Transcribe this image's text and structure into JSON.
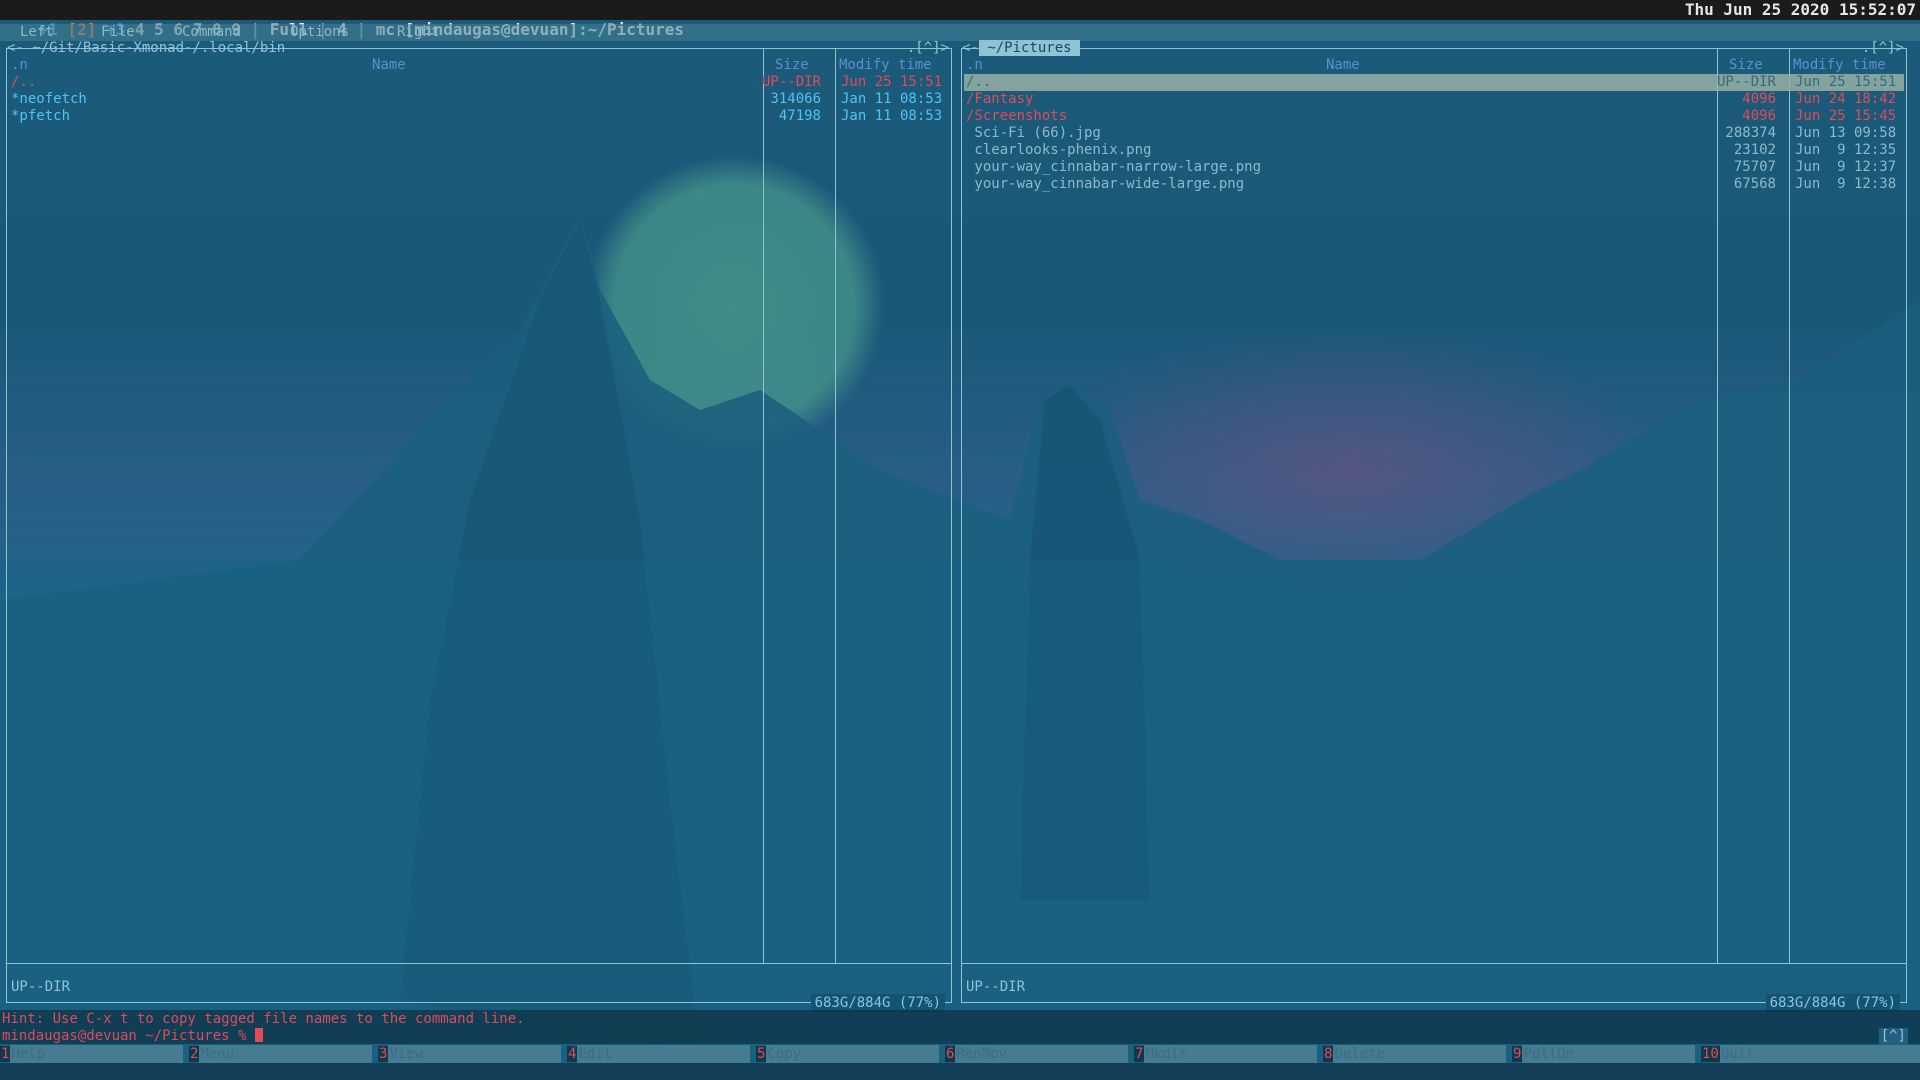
{
  "topbar": {
    "ws_prev": "+1",
    "ws_current": "[2]",
    "ws_visible": "+3",
    "ws_others": "4 5 6 7 8 9",
    "sep": "|",
    "layout": "Full",
    "window_count": "4",
    "window_title": "mc [mindaugas@devuan]:~/Pictures",
    "clock": "Thu Jun 25 2020 15:52:07"
  },
  "menubar": {
    "left": "Left",
    "file": "File",
    "command": "Command",
    "options": "Options",
    "right": "Right"
  },
  "left_panel": {
    "title": "<- ~/Git/Basic-Xmonad-/.local/bin",
    "corner": ".[^]>",
    "header": {
      "sort": ".n",
      "name": "Name",
      "size": "Size",
      "mtime": "Modify time"
    },
    "rows": [
      {
        "name": "/..",
        "size": "UP--DIR",
        "mtime": "Jun 25 15:51",
        "kind": "dir"
      },
      {
        "name": "*neofetch",
        "size": "314066",
        "mtime": "Jan 11 08:53",
        "kind": "exec"
      },
      {
        "name": "*pfetch",
        "size": "47198",
        "mtime": "Jan 11 08:53",
        "kind": "exec"
      }
    ],
    "mini_status": "UP--DIR",
    "free_space": "683G/884G (77%)"
  },
  "right_panel": {
    "title": "<- ~/Pictures",
    "title_arrow": "<-",
    "title_path": " ~/Pictures ",
    "corner": ".[^]>",
    "header": {
      "sort": ".n",
      "name": "Name",
      "size": "Size",
      "mtime": "Modify time"
    },
    "rows": [
      {
        "name": "/..",
        "size": "UP--DIR",
        "mtime": "Jun 25 15:51",
        "kind": "sel"
      },
      {
        "name": "/Fantasy",
        "size": "4096",
        "mtime": "Jun 24 18:42",
        "kind": "dir"
      },
      {
        "name": "/Screenshots",
        "size": "4096",
        "mtime": "Jun 25 15:45",
        "kind": "dir"
      },
      {
        "name": " Sci-Fi (66).jpg",
        "size": "288374",
        "mtime": "Jun 13 09:58",
        "kind": "file"
      },
      {
        "name": " clearlooks-phenix.png",
        "size": "23102",
        "mtime": "Jun  9 12:35",
        "kind": "file"
      },
      {
        "name": " your-way_cinnabar-narrow-large.png",
        "size": "75707",
        "mtime": "Jun  9 12:37",
        "kind": "file"
      },
      {
        "name": " your-way_cinnabar-wide-large.png",
        "size": "67568",
        "mtime": "Jun  9 12:38",
        "kind": "file"
      }
    ],
    "mini_status": "UP--DIR",
    "free_space": "683G/884G (77%)"
  },
  "hint": {
    "text": "Hint: Use C-x t to copy tagged file names to the command line.",
    "prompt": "mindaugas@devuan ~/Pictures % ",
    "corner": "[^]"
  },
  "fkeys": [
    {
      "num": "1",
      "label": "Help"
    },
    {
      "num": "2",
      "label": "Menu"
    },
    {
      "num": "3",
      "label": "View"
    },
    {
      "num": "4",
      "label": "Edit"
    },
    {
      "num": "5",
      "label": "Copy"
    },
    {
      "num": "6",
      "label": "RenMov"
    },
    {
      "num": "7",
      "label": "Mkdir"
    },
    {
      "num": "8",
      "label": "Delete"
    },
    {
      "num": "9",
      "label": "PullDn"
    },
    {
      "num": "10",
      "label": "Quit"
    }
  ]
}
